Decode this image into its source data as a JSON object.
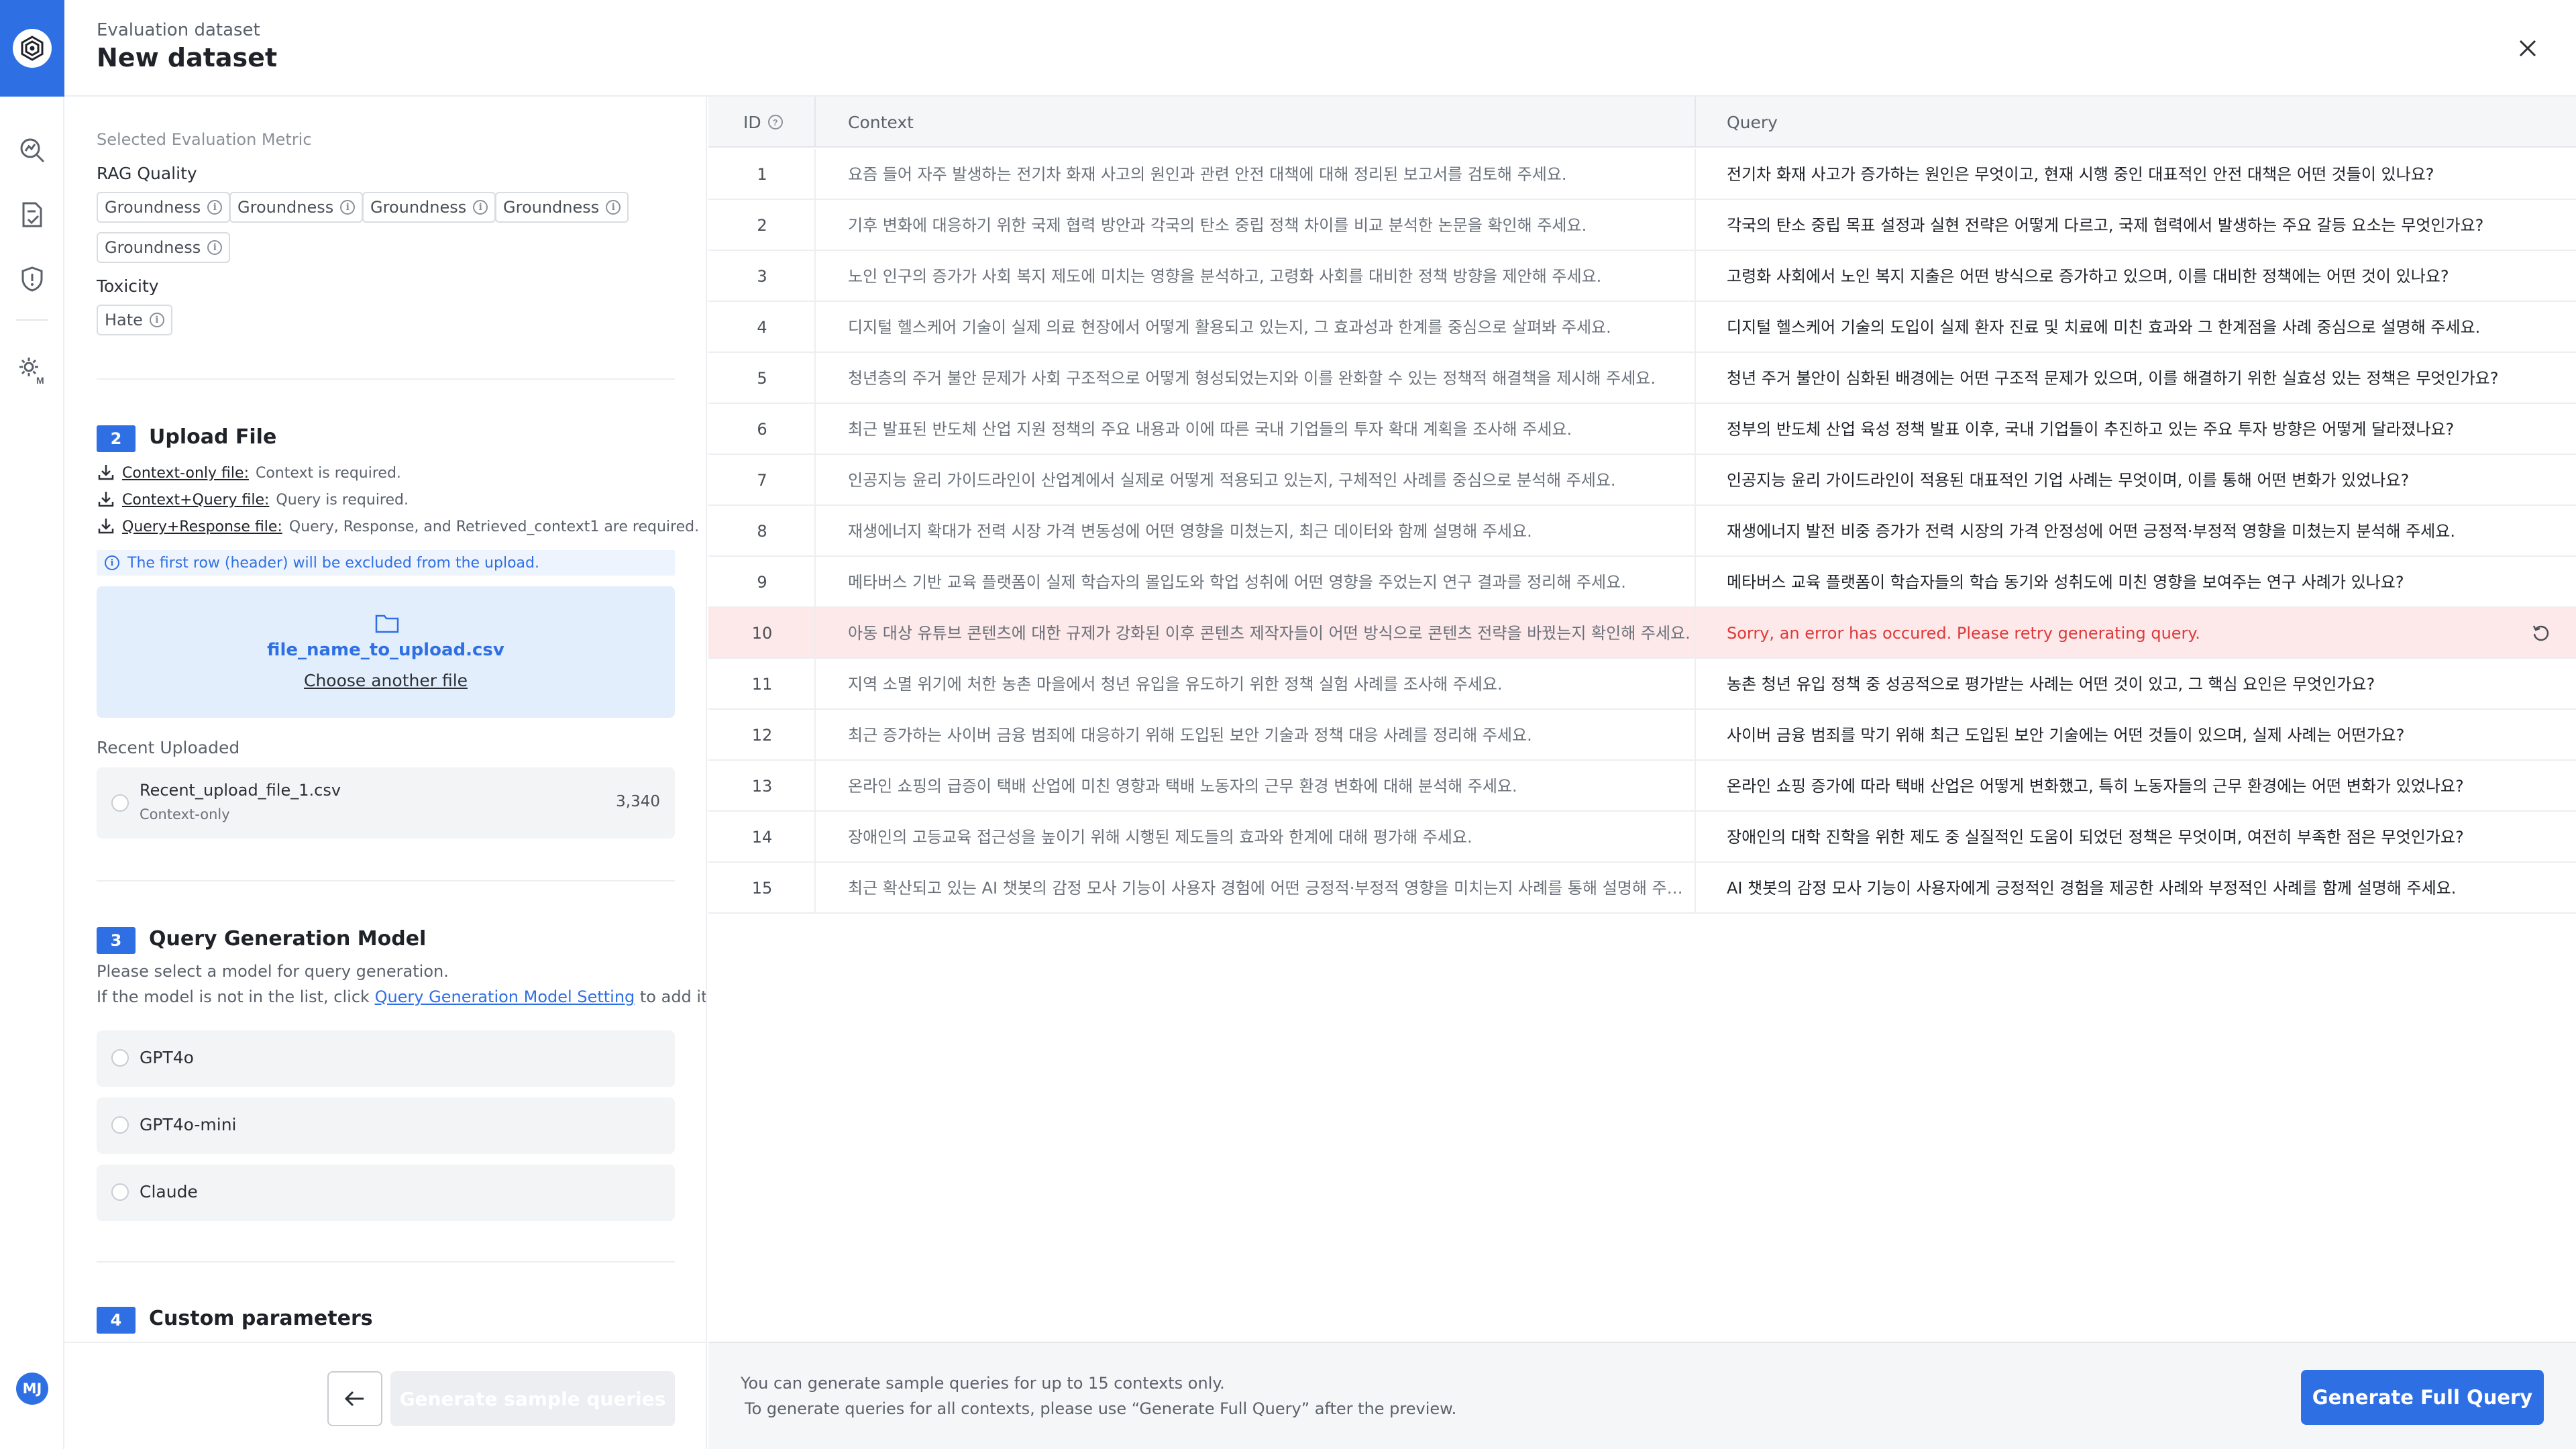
{
  "header": {
    "label": "Evaluation dataset",
    "title": "New dataset"
  },
  "avatar": {
    "initials": "MJ"
  },
  "metric": {
    "heading": "Selected Evaluation Metric",
    "groups": [
      {
        "name": "RAG Quality",
        "chips": [
          "Groundness",
          "Groundness",
          "Groundness",
          "Groundness",
          "Groundness"
        ]
      },
      {
        "name": "Toxicity",
        "chips": [
          "Hate"
        ]
      }
    ]
  },
  "upload": {
    "step": "2",
    "title": "Upload File",
    "rules": [
      {
        "name": "Context-only file:",
        "desc": "Context is required."
      },
      {
        "name": "Context+Query file:",
        "desc": "Query is required."
      },
      {
        "name": "Query+Response file:",
        "desc": "Query, Response, and Retrieved_context1 are required."
      }
    ],
    "notice": "The first row (header) will be excluded from the upload.",
    "file_name": "file_name_to_upload.csv",
    "choose_label": "Choose another file",
    "recent_heading": "Recent Uploaded",
    "recent_file": {
      "name": "Recent_upload_file_1.csv",
      "type": "Context-only",
      "count": "3,340"
    }
  },
  "model": {
    "step": "3",
    "title": "Query Generation Model",
    "desc1": "Please select a model for query generation.",
    "desc2_prefix": "If the model is not in the list, click ",
    "desc2_link": "Query Generation Model Setting",
    "desc2_suffix": " to add it.",
    "options": [
      "GPT4o",
      "GPT4o-mini",
      "Claude"
    ]
  },
  "custom": {
    "step": "4",
    "title": "Custom parameters"
  },
  "left_footer": {
    "generate_sample_label": "Generate sample queries"
  },
  "table": {
    "headers": {
      "id": "ID",
      "context": "Context",
      "query": "Query"
    },
    "rows": [
      {
        "id": "1",
        "context": "요즘 들어 자주 발생하는 전기차 화재 사고의 원인과 관련 안전 대책에 대해 정리된 보고서를 검토해 주세요.",
        "query": "전기차 화재 사고가 증가하는 원인은 무엇이고, 현재 시행 중인 대표적인 안전 대책은 어떤 것들이 있나요?"
      },
      {
        "id": "2",
        "context": "기후 변화에 대응하기 위한 국제 협력 방안과 각국의 탄소 중립 정책 차이를 비교 분석한 논문을 확인해 주세요.",
        "query": "각국의 탄소 중립 목표 설정과 실현 전략은 어떻게 다르고, 국제 협력에서 발생하는 주요 갈등 요소는 무엇인가요?"
      },
      {
        "id": "3",
        "context": "노인 인구의 증가가 사회 복지 제도에 미치는 영향을 분석하고, 고령화 사회를 대비한 정책 방향을 제안해 주세요.",
        "query": "고령화 사회에서 노인 복지 지출은 어떤 방식으로 증가하고 있으며, 이를 대비한 정책에는 어떤 것이 있나요?"
      },
      {
        "id": "4",
        "context": "디지털 헬스케어 기술이 실제 의료 현장에서 어떻게 활용되고 있는지, 그 효과성과 한계를 중심으로 살펴봐 주세요.",
        "query": "디지털 헬스케어 기술의 도입이 실제 환자 진료 및 치료에 미친 효과와 그 한계점을 사례 중심으로 설명해 주세요."
      },
      {
        "id": "5",
        "context": "청년층의 주거 불안 문제가 사회 구조적으로 어떻게 형성되었는지와 이를 완화할 수 있는 정책적 해결책을 제시해 주세요.",
        "query": "청년 주거 불안이 심화된 배경에는 어떤 구조적 문제가 있으며, 이를 해결하기 위한 실효성 있는 정책은 무엇인가요?"
      },
      {
        "id": "6",
        "context": "최근 발표된 반도체 산업 지원 정책의 주요 내용과 이에 따른 국내 기업들의 투자 확대 계획을 조사해 주세요.",
        "query": "정부의 반도체 산업 육성 정책 발표 이후, 국내 기업들이 추진하고 있는 주요 투자 방향은 어떻게 달라졌나요?"
      },
      {
        "id": "7",
        "context": "인공지능 윤리 가이드라인이 산업계에서 실제로 어떻게 적용되고 있는지, 구체적인 사례를 중심으로 분석해 주세요.",
        "query": "인공지능 윤리 가이드라인이 적용된 대표적인 기업 사례는 무엇이며, 이를 통해 어떤 변화가 있었나요?"
      },
      {
        "id": "8",
        "context": "재생에너지 확대가 전력 시장 가격 변동성에 어떤 영향을 미쳤는지, 최근 데이터와 함께 설명해 주세요.",
        "query": "재생에너지 발전 비중 증가가 전력 시장의 가격 안정성에 어떤 긍정적·부정적 영향을 미쳤는지 분석해 주세요."
      },
      {
        "id": "9",
        "context": "메타버스 기반 교육 플랫폼이 실제 학습자의 몰입도와 학업 성취에 어떤 영향을 주었는지 연구 결과를 정리해 주세요.",
        "query": "메타버스 교육 플랫폼이 학습자들의 학습 동기와 성취도에 미친 영향을 보여주는 연구 사례가 있나요?"
      },
      {
        "id": "10",
        "context": "아동 대상 유튜브 콘텐츠에 대한 규제가 강화된 이후 콘텐츠 제작자들이 어떤 방식으로 콘텐츠 전략을 바꿨는지 확인해 주세요.",
        "query": "Sorry, an error has occured. Please retry generating query.",
        "error": true
      },
      {
        "id": "11",
        "context": "지역 소멸 위기에 처한 농촌 마을에서 청년 유입을 유도하기 위한 정책 실험 사례를 조사해 주세요.",
        "query": "농촌 청년 유입 정책 중 성공적으로 평가받는 사례는 어떤 것이 있고, 그 핵심 요인은 무엇인가요?"
      },
      {
        "id": "12",
        "context": "최근 증가하는 사이버 금융 범죄에 대응하기 위해 도입된 보안 기술과 정책 대응 사례를 정리해 주세요.",
        "query": "사이버 금융 범죄를 막기 위해 최근 도입된 보안 기술에는 어떤 것들이 있으며, 실제 사례는 어떤가요?"
      },
      {
        "id": "13",
        "context": "온라인 쇼핑의 급증이 택배 산업에 미친 영향과 택배 노동자의 근무 환경 변화에 대해 분석해 주세요.",
        "query": "온라인 쇼핑 증가에 따라 택배 산업은 어떻게 변화했고, 특히 노동자들의 근무 환경에는 어떤 변화가 있었나요?"
      },
      {
        "id": "14",
        "context": "장애인의 고등교육 접근성을 높이기 위해 시행된 제도들의 효과와 한계에 대해 평가해 주세요.",
        "query": "장애인의 대학 진학을 위한 제도 중 실질적인 도움이 되었던 정책은 무엇이며, 여전히 부족한 점은 무엇인가요?"
      },
      {
        "id": "15",
        "context": "최근 확산되고 있는 AI 챗봇의 감정 모사 기능이 사용자 경험에 어떤 긍정적·부정적 영향을 미치는지 사례를 통해 설명해 주세…",
        "query": "AI 챗봇의 감정 모사 기능이 사용자에게 긍정적인 경험을 제공한 사례와 부정적인 사례를 함께 설명해 주세요."
      }
    ]
  },
  "right_footer": {
    "note1": "You can generate sample queries for up to 15 contexts only.",
    "note2": "To generate queries for all contexts, please use “Generate Full Query” after the preview.",
    "generate_full_label": "Generate Full Query"
  },
  "colors": {
    "accent": "#2f6fe4",
    "error_bg": "#fde9ea",
    "error_text": "#e03838"
  },
  "icons": [
    "app-logo-icon",
    "analytics-icon",
    "document-check-icon",
    "shield-alert-icon",
    "settings-model-icon",
    "close-icon",
    "download-icon",
    "folder-icon",
    "info-icon",
    "help-icon",
    "retry-icon",
    "arrow-left-icon"
  ]
}
